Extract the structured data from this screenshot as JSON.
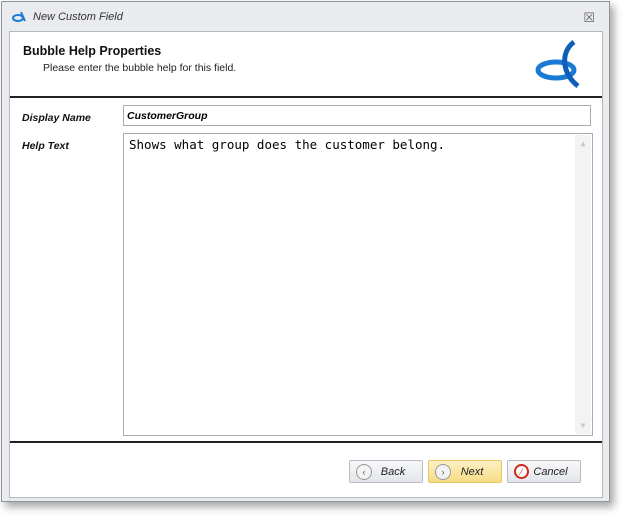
{
  "window": {
    "title": "New Custom Field",
    "close_icon": "close-icon"
  },
  "header": {
    "title": "Bubble Help Properties",
    "subtitle": "Please enter the bubble help for this field."
  },
  "form": {
    "display_name_label": "Display Name",
    "display_name_value": "CustomerGroup",
    "help_text_label": "Help Text",
    "help_text_value": "Shows what group does the customer belong."
  },
  "buttons": {
    "back": "Back",
    "next": "Next",
    "cancel": "Cancel"
  },
  "colors": {
    "accent": "#1a7bd6",
    "next_bg": "#f8dc84"
  }
}
